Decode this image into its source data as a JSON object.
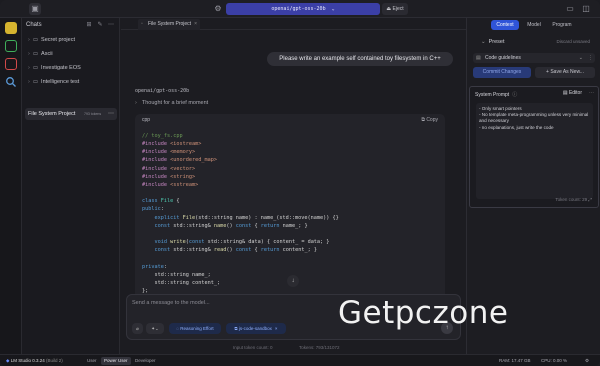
{
  "topbar": {
    "model_id": "openai/gpt-oss-20b",
    "eject_label": "Eject"
  },
  "sidebar": {
    "title": "Chats",
    "folders": [
      {
        "label": "Secret project"
      },
      {
        "label": "Ascii"
      },
      {
        "label": "Investigate EOS"
      },
      {
        "label": "Intelligence test"
      }
    ],
    "selected_chat": {
      "title": "File System Project",
      "tokens": "793 tokens"
    }
  },
  "tab": {
    "label": "File System Project"
  },
  "conversation": {
    "user_message": "Please write an example self contained toy filesystem in C++",
    "model_name": "openai/gpt-oss-20b",
    "thought_label": "Thought for a brief moment",
    "code_language": "cpp",
    "copy_label": "Copy",
    "code_lines": [
      {
        "cls": "cm",
        "text": "// toy_fs.cpp"
      },
      {
        "cls": "",
        "parts": [
          [
            "pp",
            "#include "
          ],
          [
            "inc",
            "<iostream>"
          ]
        ]
      },
      {
        "cls": "",
        "parts": [
          [
            "pp",
            "#include "
          ],
          [
            "inc",
            "<memory>"
          ]
        ]
      },
      {
        "cls": "",
        "parts": [
          [
            "pp",
            "#include "
          ],
          [
            "inc",
            "<unordered_map>"
          ]
        ]
      },
      {
        "cls": "",
        "parts": [
          [
            "pp",
            "#include "
          ],
          [
            "inc",
            "<vector>"
          ]
        ]
      },
      {
        "cls": "",
        "parts": [
          [
            "pp",
            "#include "
          ],
          [
            "inc",
            "<string>"
          ]
        ]
      },
      {
        "cls": "",
        "parts": [
          [
            "pp",
            "#include "
          ],
          [
            "inc",
            "<sstream>"
          ]
        ]
      },
      {
        "cls": "",
        "text": ""
      },
      {
        "cls": "",
        "parts": [
          [
            "kw",
            "class "
          ],
          [
            "ty",
            "File"
          ],
          [
            "",
            " {"
          ]
        ]
      },
      {
        "cls": "",
        "parts": [
          [
            "kw",
            "public"
          ],
          [
            "",
            ":"
          ]
        ]
      },
      {
        "cls": "",
        "parts": [
          [
            "",
            "    "
          ],
          [
            "kw",
            "explicit "
          ],
          [
            "fn",
            "File"
          ],
          [
            "",
            "(std::string name) : name_(std::move(name)) {}"
          ]
        ]
      },
      {
        "cls": "",
        "parts": [
          [
            "",
            "    "
          ],
          [
            "kw",
            "const "
          ],
          [
            "",
            "std::string& "
          ],
          [
            "fn",
            "name"
          ],
          [
            "",
            "() "
          ],
          [
            "kw",
            "const"
          ],
          [
            "",
            " { "
          ],
          [
            "kw",
            "return"
          ],
          [
            "",
            " name_; }"
          ]
        ]
      },
      {
        "cls": "",
        "text": ""
      },
      {
        "cls": "",
        "parts": [
          [
            "",
            "    "
          ],
          [
            "kw",
            "void "
          ],
          [
            "fn",
            "write"
          ],
          [
            "",
            "("
          ],
          [
            "kw",
            "const "
          ],
          [
            "",
            "std::string& data) { content_ = data; }"
          ]
        ]
      },
      {
        "cls": "",
        "parts": [
          [
            "",
            "    "
          ],
          [
            "kw",
            "const "
          ],
          [
            "",
            "std::string& "
          ],
          [
            "fn",
            "read"
          ],
          [
            "",
            "() "
          ],
          [
            "kw",
            "const"
          ],
          [
            "",
            " { "
          ],
          [
            "kw",
            "return"
          ],
          [
            "",
            " content_; }"
          ]
        ]
      },
      {
        "cls": "",
        "text": ""
      },
      {
        "cls": "",
        "parts": [
          [
            "kw",
            "private"
          ],
          [
            "",
            ":"
          ]
        ]
      },
      {
        "cls": "",
        "text": "    std::string name_;"
      },
      {
        "cls": "",
        "text": "    std::string content_;"
      },
      {
        "cls": "",
        "text": "};"
      }
    ]
  },
  "composer": {
    "placeholder": "Send a message to the model...",
    "reasoning_label": "Reasoning Effort",
    "sandbox_label": "js-code-sandbox",
    "input_tokens": "Input token count: 0",
    "context_tokens": "Tokens: 793/131072"
  },
  "right_panel": {
    "tabs": [
      "Context",
      "Model",
      "Program"
    ],
    "active_tab": "Context",
    "preset_label": "Preset",
    "discard_label": "Discard unsaved",
    "preset_value": "Code guidelines",
    "commit_label": "Commit Changes",
    "save_as_label": "Save As New...",
    "system_prompt_label": "System Prompt",
    "editor_label": "Editor",
    "system_prompt_lines": [
      "- Only smart pointers",
      "- No template meta-programming unless very minimal and necessary",
      "- no explanations, just write the code"
    ],
    "token_count": "Token count: 29"
  },
  "statusbar": {
    "app": "LM Studio 0.3.24",
    "build": "(Build 2)",
    "modes": [
      "User",
      "Power User",
      "Developer"
    ],
    "active_mode": "Power User",
    "ram": "RAM: 17.47 GB",
    "cpu": "CPU: 0.00 %"
  },
  "watermark": "Getpczone",
  "colors": {
    "accent": "#3b3fa6",
    "active_tab": "#2f54d8"
  }
}
